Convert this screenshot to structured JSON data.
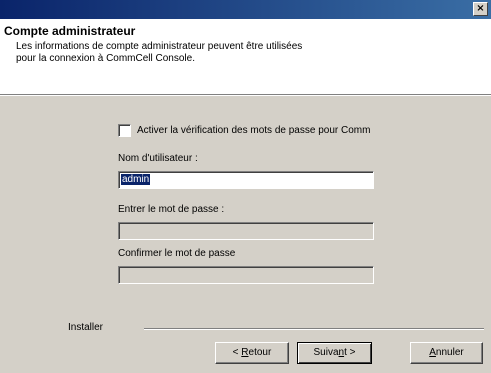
{
  "window": {
    "close_glyph": "×"
  },
  "header": {
    "title": "Compte administrateur",
    "description": "Les informations de compte administrateur peuvent être utilisées pour la connexion à CommCell Console."
  },
  "form": {
    "checkbox_label": "Activer la vérification des mots de passe pour Comm",
    "checkbox_checked": false,
    "username_label": "Nom d'utilisateur :",
    "username_value": "admin",
    "password_label": "Entrer le mot de passe :",
    "password_value": "",
    "confirm_label": "Confirmer le mot de passe",
    "confirm_value": ""
  },
  "footer": {
    "install_label": "Installer",
    "back_prefix": "< ",
    "back_mnemonic": "R",
    "back_rest": "etour",
    "next_prefix": "Suiva",
    "next_mnemonic": "n",
    "next_rest": "t >",
    "cancel_mnemonic": "A",
    "cancel_rest": "nnuler"
  },
  "colors": {
    "titlebar_start": "#0a246a",
    "titlebar_end": "#3a6ea5",
    "dialog_face": "#d4d0c8",
    "selection": "#0a246a"
  }
}
